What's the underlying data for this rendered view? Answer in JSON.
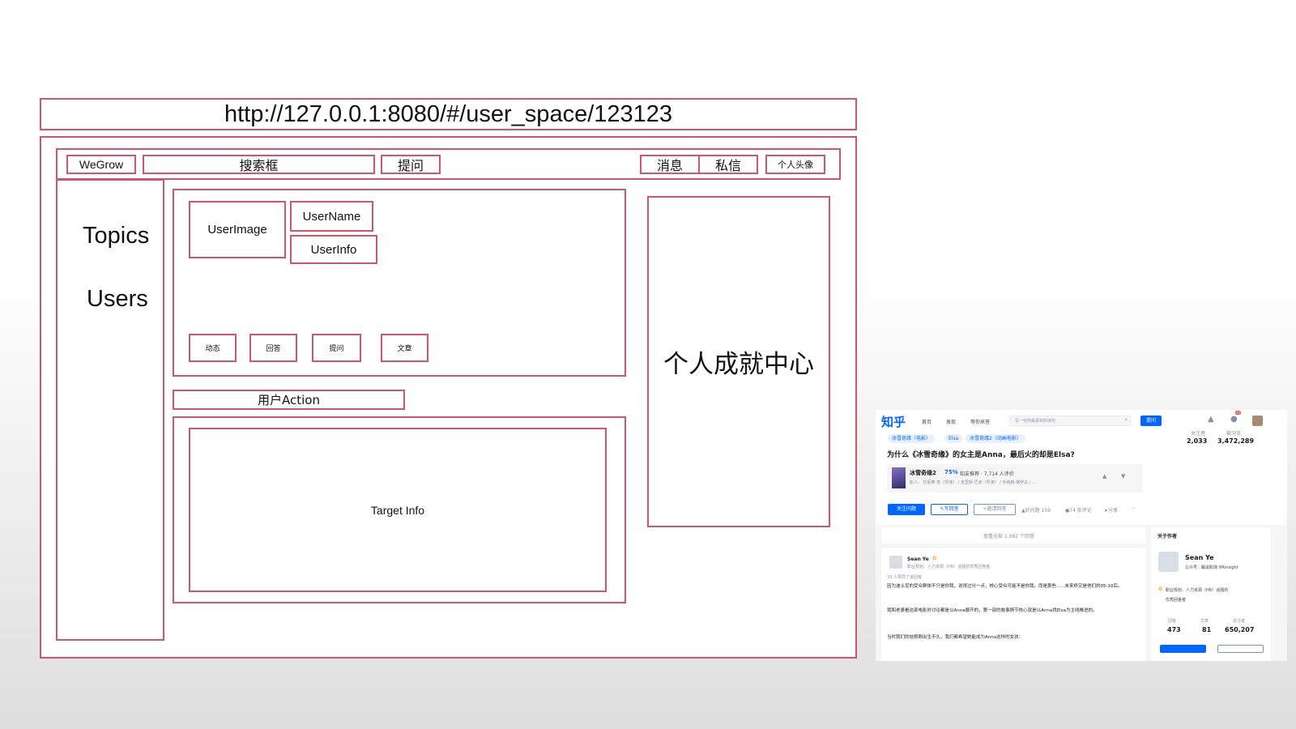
{
  "wireframe": {
    "url": "http://127.0.0.1:8080/#/user_space/123123",
    "header": {
      "logo": "WeGrow",
      "search": "搜索框",
      "ask": "提问",
      "messages": "消息",
      "private_msg": "私信",
      "avatar": "个人头像"
    },
    "sidebar": {
      "topics": "Topics",
      "users": "Users"
    },
    "profile": {
      "user_image": "UserImage",
      "user_name": "UserName",
      "user_info": "UserInfo",
      "tabs": [
        "动态",
        "回答",
        "提问",
        "文章"
      ]
    },
    "user_action": "用户Action",
    "target_info": "Target Info",
    "achievement": "个人成就中心",
    "border_color": "#d4546e"
  },
  "zhihu": {
    "brand_color": "#0066ff",
    "logo": "知乎",
    "nav": [
      "首页",
      "发现",
      "等你来答"
    ],
    "search_placeholder": "写一句你最喜欢的诗句",
    "ask_button": "提问",
    "notification_badge": "40",
    "topics": [
      "冰雪奇缘（电影）",
      "Elsa",
      "冰雪奇缘2（动画电影）"
    ],
    "question_title": "为什么《冰雪奇缘》的女主是Anna，最后火的却是Elsa?",
    "stats": {
      "followers_label": "关注者",
      "followers": "2,033",
      "views_label": "被浏览",
      "views": "3,472,289"
    },
    "movie": {
      "title": "冰雪奇缘2",
      "score": "75%",
      "rating_text": "知友推荐 · 7,714 人评价",
      "credits": "影人：  珍妮弗·李（导演） / 克里斯·巴克（导演） / 乔纳森·格罗夫 / ..."
    },
    "actions": [
      "关注问题",
      "写回答",
      "邀请回答",
      "好问题 159",
      "74 条评论",
      "分享",
      "···"
    ],
    "view_all": "查看全部 1,082 个回答",
    "answer": {
      "author": "Sean Ye",
      "bio": "职业规划、人力资源（HR）话题的优秀回答者",
      "likes": "33 人赞同了该回答",
      "para1": "因为迪士尼的受众群体不只是你我，说得过分一点，核心受众可能不是你我。而是那些......未来终究是他们的05-10后。",
      "para2": "我和老婆看这部电影时讨论都是以Anna展开的，第一部的故事情节核心就是以Anna找Elsa为主线推进的。",
      "para3": "当时我们的娃刚刚出生不久，我们都希望她能成为Anna这样的女孩："
    },
    "about": {
      "heading": "关于作者",
      "name": "Sean Ye",
      "desc": "公众号：瞩说职场 HRinsight",
      "badge": "职业规划、人力资源（HR）话题的",
      "badge2": "优秀回答者",
      "labels": [
        "回答",
        "文章",
        "关注者"
      ],
      "values": [
        "473",
        "81",
        "650,207"
      ]
    }
  }
}
